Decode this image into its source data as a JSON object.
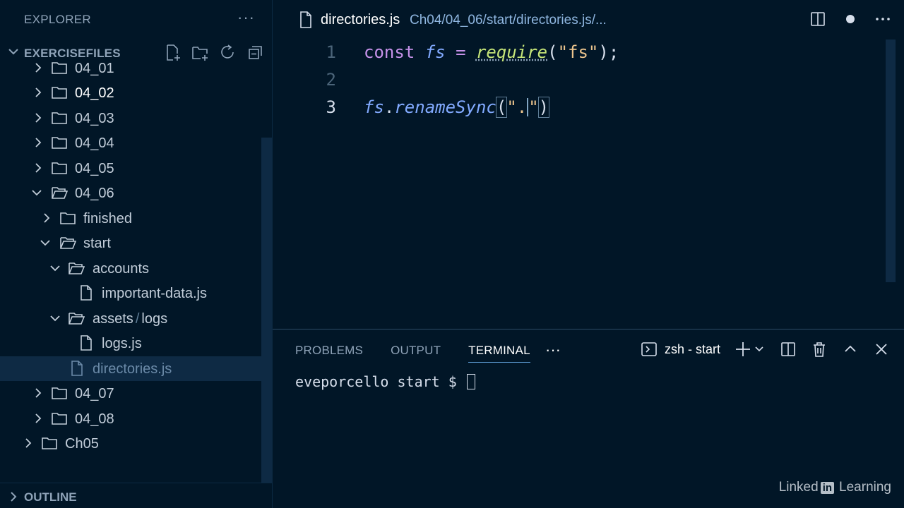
{
  "sidebar": {
    "title": "EXPLORER",
    "more": "···",
    "section_label": "EXERCISEFILES",
    "outline_label": "OUTLINE",
    "tree": [
      {
        "name": "04_01",
        "type": "folder",
        "expanded": false
      },
      {
        "name": "04_02",
        "type": "folder",
        "expanded": false
      },
      {
        "name": "04_03",
        "type": "folder",
        "expanded": false
      },
      {
        "name": "04_04",
        "type": "folder",
        "expanded": false
      },
      {
        "name": "04_05",
        "type": "folder",
        "expanded": false
      },
      {
        "name": "04_06",
        "type": "folder",
        "expanded": true
      },
      {
        "name": "finished",
        "type": "folder",
        "expanded": false
      },
      {
        "name": "start",
        "type": "folder",
        "expanded": true
      },
      {
        "name": "accounts",
        "type": "folder",
        "expanded": true
      },
      {
        "name": "important-data.js",
        "type": "file"
      },
      {
        "name": "assets",
        "name_sep": "/",
        "name_extra": "logs",
        "type": "folder",
        "expanded": true
      },
      {
        "name": "logs.js",
        "type": "file"
      },
      {
        "name": "directories.js",
        "type": "file",
        "selected": true
      },
      {
        "name": "04_07",
        "type": "folder",
        "expanded": false
      },
      {
        "name": "04_08",
        "type": "folder",
        "expanded": false
      },
      {
        "name": "Ch05",
        "type": "folder",
        "expanded": false
      }
    ]
  },
  "editor": {
    "tab_name": "directories.js",
    "tab_path": "Ch04/04_06/start/directories.js/...",
    "line_numbers": [
      "1",
      "2",
      "3"
    ],
    "line1": {
      "kw": "const",
      "var": "fs",
      "op": "=",
      "fn": "require",
      "p1": "(",
      "str": "\"fs\"",
      "p2": ");"
    },
    "line3": {
      "obj": "fs",
      "dot": ".",
      "method": "renameSync",
      "p1": "(",
      "str_open": "\".",
      "str_close": "\"",
      "p2": ")"
    }
  },
  "panel": {
    "tabs": [
      "PROBLEMS",
      "OUTPUT",
      "TERMINAL"
    ],
    "more": "···",
    "shell_label": "zsh - start",
    "terminal_prompt": "eveporcello start $ "
  },
  "watermark": {
    "prefix": "Linked",
    "in": "in",
    "suffix": "Learning"
  },
  "colors": {
    "background": "#011627",
    "keyword": "#c792ea",
    "function": "#82aaff",
    "string": "#ecc48d",
    "selection": "#0e2a44"
  }
}
